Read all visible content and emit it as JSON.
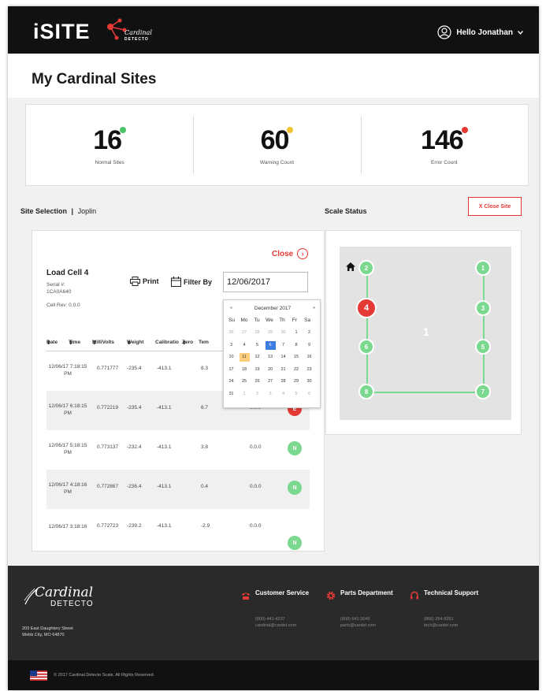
{
  "header": {
    "logo_text": "iSITE",
    "brand_name": "Cardinal",
    "brand_sub": "DETECTO",
    "greeting": "Hello Jonathan"
  },
  "page_title": "My Cardinal Sites",
  "stats": [
    {
      "value": "16",
      "label": "Normal Sites",
      "dot_color": "#4cc46a"
    },
    {
      "value": "60",
      "label": "Warning Count",
      "dot_color": "#f2c230"
    },
    {
      "value": "146",
      "label": "Error Count",
      "dot_color": "#e53935"
    }
  ],
  "site_selection": {
    "label": "Site Selection",
    "separator": "|",
    "site": "Joplin"
  },
  "scale_status": {
    "title": "Scale Status",
    "close_site_label": "X Close Site",
    "center_label": "1"
  },
  "load_cell": {
    "close_label": "Close",
    "title": "Load Cell 4",
    "serial_label": "Serial #:",
    "serial": "1CA0A640",
    "cell_rev": "Cell Rev: 0.0.0",
    "print_label": "Print",
    "filter_label": "Filter By",
    "filter_date": "12/06/2017"
  },
  "table": {
    "headers": [
      "Date",
      "Time",
      "MilliVolts",
      "Weight",
      "Calibratio",
      "Zero",
      "Tem"
    ],
    "rows": [
      {
        "datetime": "12/06/17 7:18:15 PM",
        "mv": "0.771777",
        "weight": "-235.4",
        "cal": "-413.1",
        "zero": "8.3",
        "temp": "",
        "status": "",
        "alt": false
      },
      {
        "datetime": "12/06/17 6:18:15 PM",
        "mv": "0.772219",
        "weight": "-235.4",
        "cal": "-413.1",
        "zero": "6.7",
        "temp": "0.0.0",
        "status": "E",
        "alt": true
      },
      {
        "datetime": "12/06/17 5:18:15 PM",
        "mv": "0.773137",
        "weight": "-232.4",
        "cal": "-413.1",
        "zero": "3.8",
        "temp": "0.0.0",
        "status": "N",
        "alt": false
      },
      {
        "datetime": "12/06/17 4:18:16 PM",
        "mv": "0.772867",
        "weight": "-236.4",
        "cal": "-413.1",
        "zero": "0.4",
        "temp": "0.0.0",
        "status": "N",
        "alt": true
      },
      {
        "datetime": "12/06/17 3:18:16",
        "mv": "0.772723",
        "weight": "-239.2",
        "cal": "-413.1",
        "zero": "-2.9",
        "temp": "0.0.0",
        "status": "N",
        "alt": false
      }
    ]
  },
  "calendar": {
    "prev": "«",
    "next": "»",
    "month": "December 2017",
    "dow": [
      "Su",
      "Mo",
      "Tu",
      "We",
      "Th",
      "Fr",
      "Sa"
    ],
    "weeks": [
      [
        "26",
        "27",
        "28",
        "29",
        "30",
        "1",
        "2"
      ],
      [
        "3",
        "4",
        "5",
        "6",
        "7",
        "8",
        "9"
      ],
      [
        "10",
        "11",
        "12",
        "13",
        "14",
        "15",
        "16"
      ],
      [
        "17",
        "18",
        "19",
        "20",
        "21",
        "22",
        "23"
      ],
      [
        "24",
        "25",
        "26",
        "27",
        "28",
        "29",
        "30"
      ],
      [
        "31",
        "1",
        "2",
        "3",
        "4",
        "5",
        "6"
      ]
    ],
    "selected": "6",
    "today": "11"
  },
  "scale_nodes": [
    {
      "id": "2",
      "state": "normal"
    },
    {
      "id": "1",
      "state": "normal"
    },
    {
      "id": "4",
      "state": "error"
    },
    {
      "id": "3",
      "state": "normal"
    },
    {
      "id": "6",
      "state": "normal"
    },
    {
      "id": "5",
      "state": "normal"
    },
    {
      "id": "8",
      "state": "normal"
    },
    {
      "id": "7",
      "state": "normal"
    }
  ],
  "footer": {
    "brand_script": "Cardinal",
    "brand_caps": "DETECTO",
    "address_line1": "203 East Daughtery Street",
    "address_line2": "Webb City, MO 64870",
    "columns": [
      {
        "title": "Customer Service",
        "phone": "(800) 441-4237",
        "email": "cardinal@cardet.com"
      },
      {
        "title": "Parts Department",
        "phone": "(800) 641-2045",
        "email": "parts@cardet.com"
      },
      {
        "title": "Technical Support",
        "phone": "(866) 254-8261",
        "email": "tech@cardet.com"
      }
    ],
    "copyright": "© 2017 Cardinal Detecto Scale. All Rights Reserved"
  },
  "colors": {
    "normal": "#7bd88f",
    "error": "#e53935",
    "accent_red": "#e53935"
  }
}
